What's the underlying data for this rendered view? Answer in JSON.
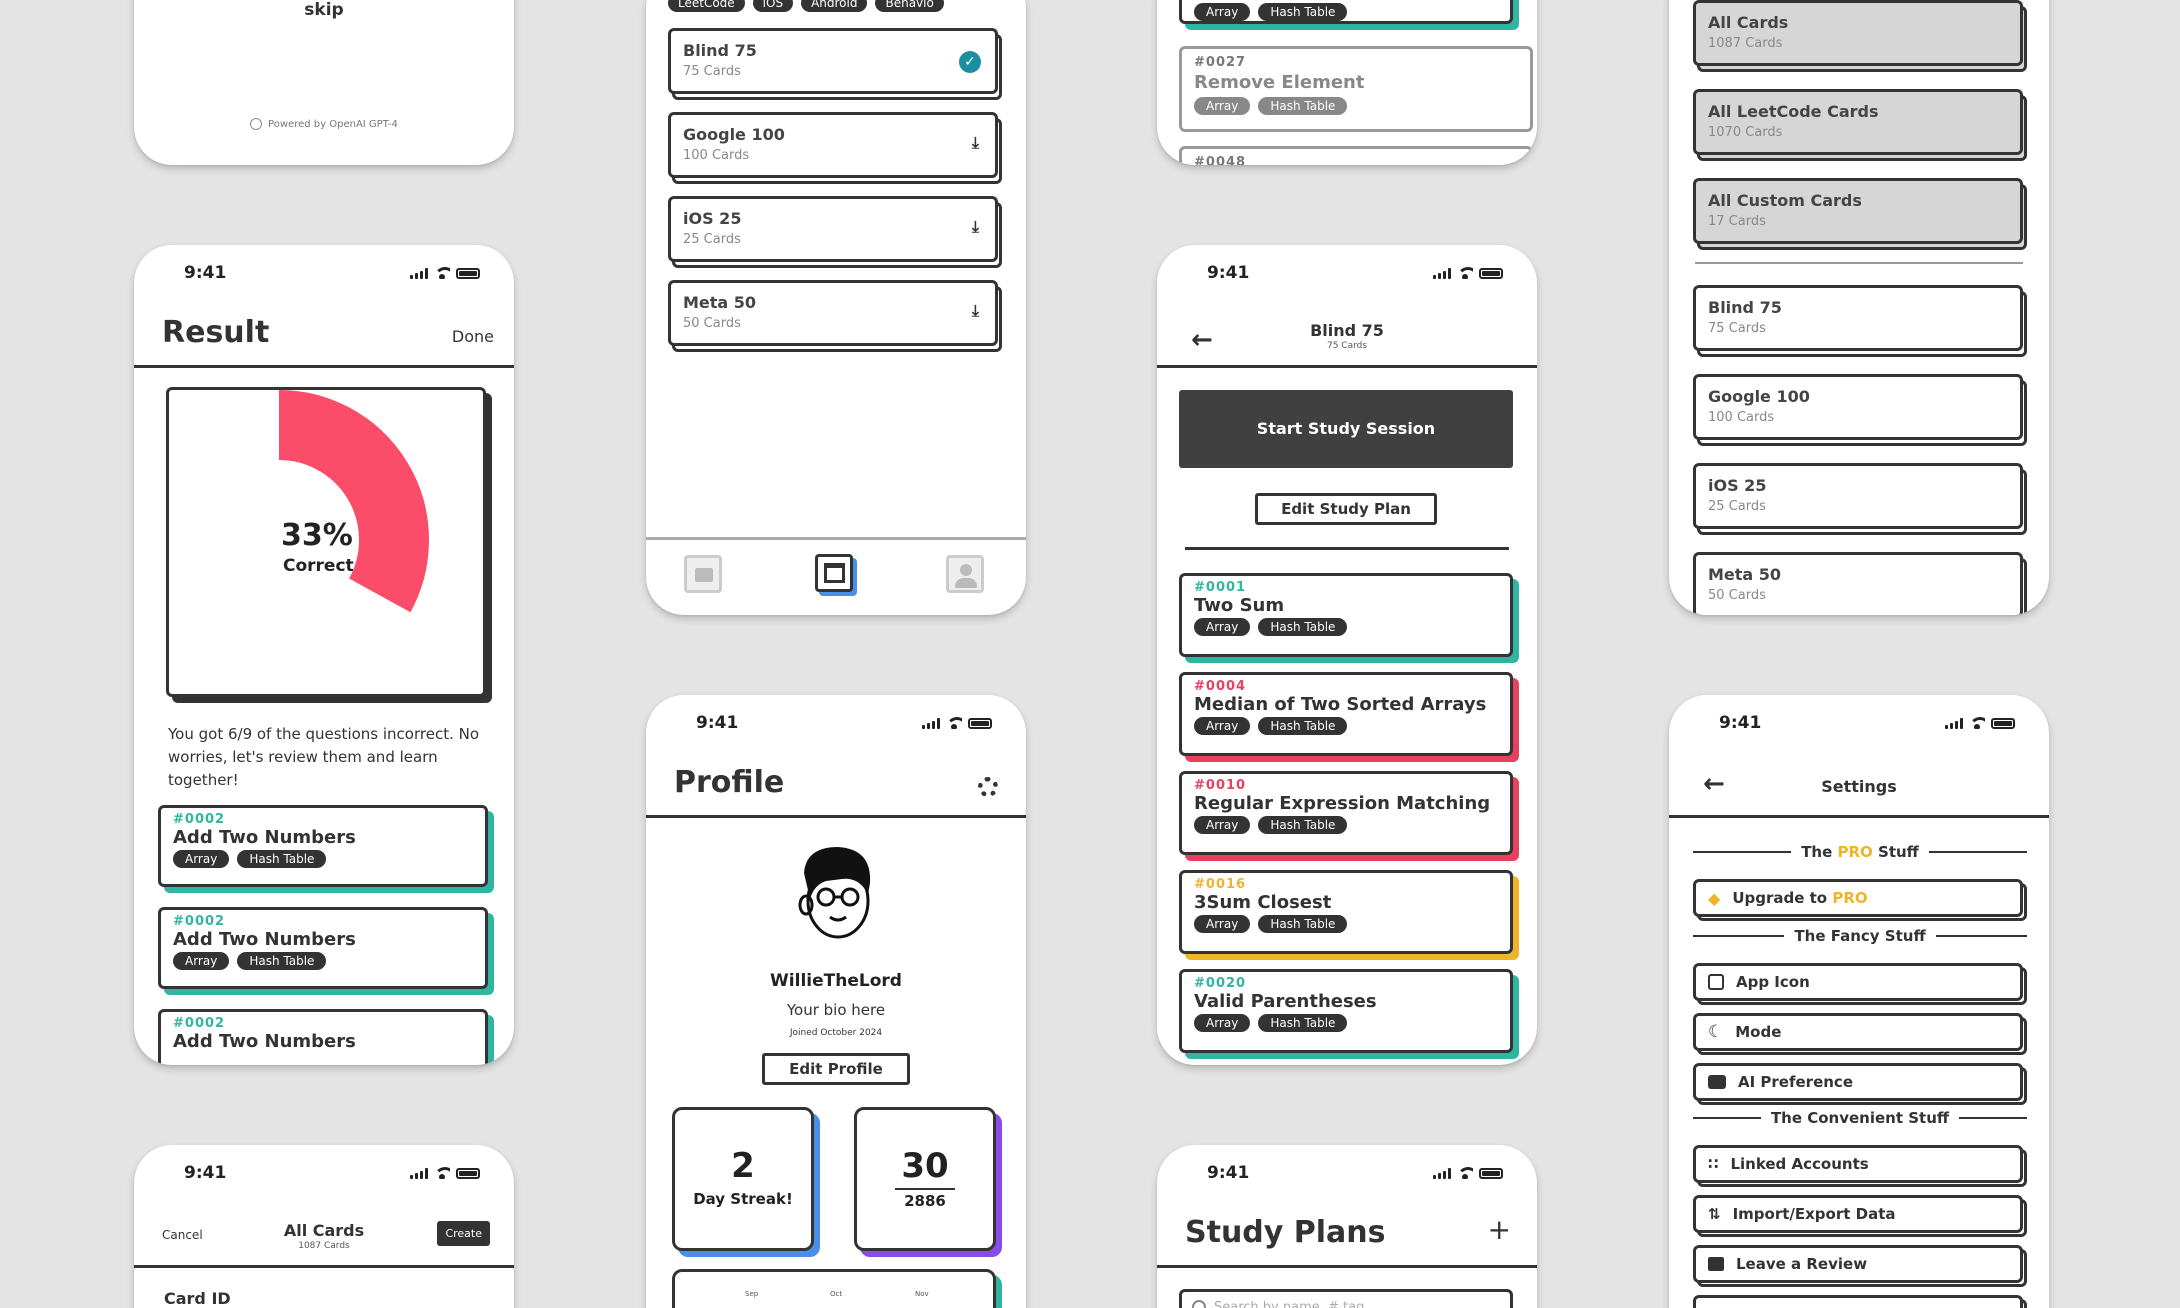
{
  "onboarding": {
    "skip_label": "skip",
    "powered_by": "Powered by OpenAI GPT-4"
  },
  "status_time": "9:41",
  "result": {
    "title": "Result",
    "done_label": "Done",
    "percent": "33%",
    "percent_label": "Correct",
    "fraction_correct": 0.33,
    "message": "You got 6/9 of the questions incorrect. No worries, let's review them and learn together!",
    "cards": [
      {
        "id": "#0002",
        "title": "Add Two Numbers",
        "tags": [
          "Array",
          "Hash Table"
        ]
      },
      {
        "id": "#0002",
        "title": "Add Two Numbers",
        "tags": [
          "Array",
          "Hash Table"
        ]
      },
      {
        "id": "#0002",
        "title": "Add Two Numbers",
        "tags": []
      }
    ]
  },
  "create_card": {
    "cancel_label": "Cancel",
    "title": "All Cards",
    "subtitle": "1087 Cards",
    "create_label": "Create",
    "field_label": "Card ID"
  },
  "library": {
    "filters": [
      "LeetCode",
      "iOS",
      "Android",
      "Behavio"
    ],
    "decks": [
      {
        "title": "Blind 75",
        "count": "75 Cards",
        "state": "downloaded"
      },
      {
        "title": "Google 100",
        "count": "100 Cards",
        "state": "download"
      },
      {
        "title": "iOS 25",
        "count": "25 Cards",
        "state": "download"
      },
      {
        "title": "Meta 50",
        "count": "50 Cards",
        "state": "download"
      }
    ]
  },
  "profile": {
    "title": "Profile",
    "username": "WillieTheLord",
    "bio": "Your bio here",
    "joined": "Joined October 2024",
    "edit_label": "Edit Profile",
    "streak_value": "2",
    "streak_label": "Day Streak!",
    "score_value": "30",
    "score_total": "2886",
    "months": [
      "Sep",
      "Oct",
      "Nov"
    ]
  },
  "search_results": {
    "top_tags": [
      "Array",
      "Hash Table"
    ],
    "card": {
      "id": "#0027",
      "title": "Remove Element",
      "tags": [
        "Array",
        "Hash Table"
      ]
    },
    "next_id": "#0048"
  },
  "study_detail": {
    "title": "Blind 75",
    "subtitle": "75 Cards",
    "start_label": "Start Study Session",
    "edit_label": "Edit Study Plan",
    "cards": [
      {
        "id": "#0001",
        "title": "Two Sum",
        "tags": [
          "Array",
          "Hash Table"
        ],
        "color": "#2fb5a0"
      },
      {
        "id": "#0004",
        "title": "Median of Two Sorted Arrays",
        "tags": [
          "Array",
          "Hash Table"
        ],
        "color": "#e8405f"
      },
      {
        "id": "#0010",
        "title": "Regular Expression Matching",
        "tags": [
          "Array",
          "Hash Table"
        ],
        "color": "#e8405f"
      },
      {
        "id": "#0016",
        "title": "3Sum Closest",
        "tags": [
          "Array",
          "Hash Table"
        ],
        "color": "#f0b429"
      },
      {
        "id": "#0020",
        "title": "Valid Parentheses",
        "tags": [
          "Array",
          "Hash Table"
        ],
        "color": "#2fb5a0"
      }
    ]
  },
  "study_plans": {
    "title": "Study Plans",
    "search_placeholder": "Search by name, # tag"
  },
  "collections": {
    "groups": [
      {
        "title": "All Cards",
        "count": "1087 Cards"
      },
      {
        "title": "All LeetCode Cards",
        "count": "1070 Cards"
      },
      {
        "title": "All Custom Cards",
        "count": "17 Cards"
      }
    ],
    "decks": [
      {
        "title": "Blind 75",
        "count": "75 Cards"
      },
      {
        "title": "Google 100",
        "count": "100 Cards"
      },
      {
        "title": "iOS 25",
        "count": "25 Cards"
      },
      {
        "title": "Meta 50",
        "count": "50 Cards"
      }
    ]
  },
  "settings": {
    "title": "Settings",
    "sections": {
      "pro_prefix": "The ",
      "pro_word": "PRO",
      "pro_suffix": " Stuff",
      "fancy": "The Fancy Stuff",
      "convenient": "The Convenient Stuff"
    },
    "upgrade_prefix": "Upgrade to ",
    "upgrade_word": "PRO",
    "items": {
      "app_icon": "App Icon",
      "mode": "Mode",
      "ai": "AI Preference",
      "linked": "Linked Accounts",
      "import": "Import/Export Data",
      "review": "Leave a Review"
    }
  },
  "colors": {
    "teal": "#2fb5a0",
    "red": "#e8405f",
    "yellow": "#f0b429",
    "blue": "#4a8fe7",
    "purple": "#8a4ce8",
    "dark": "#333333"
  }
}
